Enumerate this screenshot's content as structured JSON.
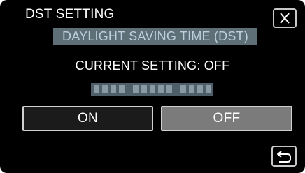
{
  "header": {
    "title": "DST SETTING",
    "subtitle": "DAYLIGHT SAVING TIME (DST)",
    "close_icon": "close-x-icon"
  },
  "status": {
    "current_setting": "CURRENT SETTING: OFF"
  },
  "options": {
    "on_label": "ON",
    "off_label": "OFF"
  },
  "footer": {
    "back_icon": "return-arrow-icon"
  }
}
